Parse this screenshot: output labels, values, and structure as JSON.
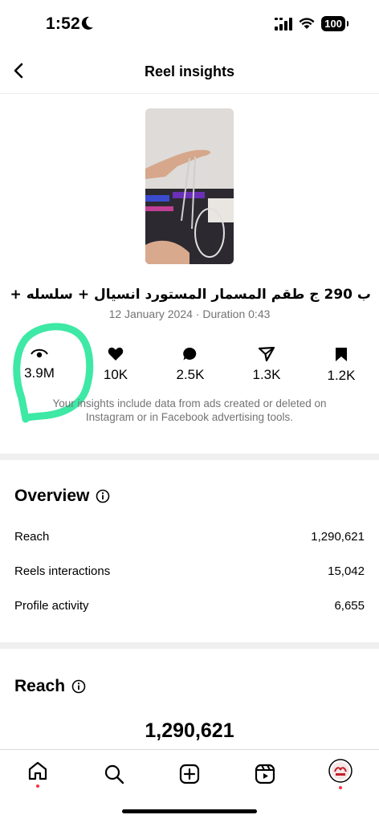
{
  "status_bar": {
    "time": "1:52",
    "battery": "100"
  },
  "header": {
    "title": "Reel insights"
  },
  "reel": {
    "caption": "ب 290 ج طقم المسمار المستورد انسيال + سلسله + بوكس شيـ...",
    "meta": "12 January 2024 · Duration 0:43"
  },
  "stats": [
    {
      "icon": "eye-icon",
      "value": "3.9M"
    },
    {
      "icon": "heart-icon",
      "value": "10K"
    },
    {
      "icon": "comment-icon",
      "value": "2.5K"
    },
    {
      "icon": "share-icon",
      "value": "1.3K"
    },
    {
      "icon": "bookmark-icon",
      "value": "1.2K"
    }
  ],
  "disclaimer": "Your insights include data from ads created or deleted on Instagram or in Facebook advertising tools.",
  "overview": {
    "title": "Overview",
    "rows": [
      {
        "label": "Reach",
        "value": "1,290,621"
      },
      {
        "label": "Reels interactions",
        "value": "15,042"
      },
      {
        "label": "Profile activity",
        "value": "6,655"
      }
    ]
  },
  "reach": {
    "title": "Reach",
    "value": "1,290,621"
  },
  "tab_bar": {
    "items": [
      "home-icon",
      "search-icon",
      "create-icon",
      "reels-icon",
      "profile-avatar"
    ],
    "accent": "#ff3040"
  },
  "colors": {
    "annotation": "#3ee8a5",
    "muted": "#737373"
  }
}
